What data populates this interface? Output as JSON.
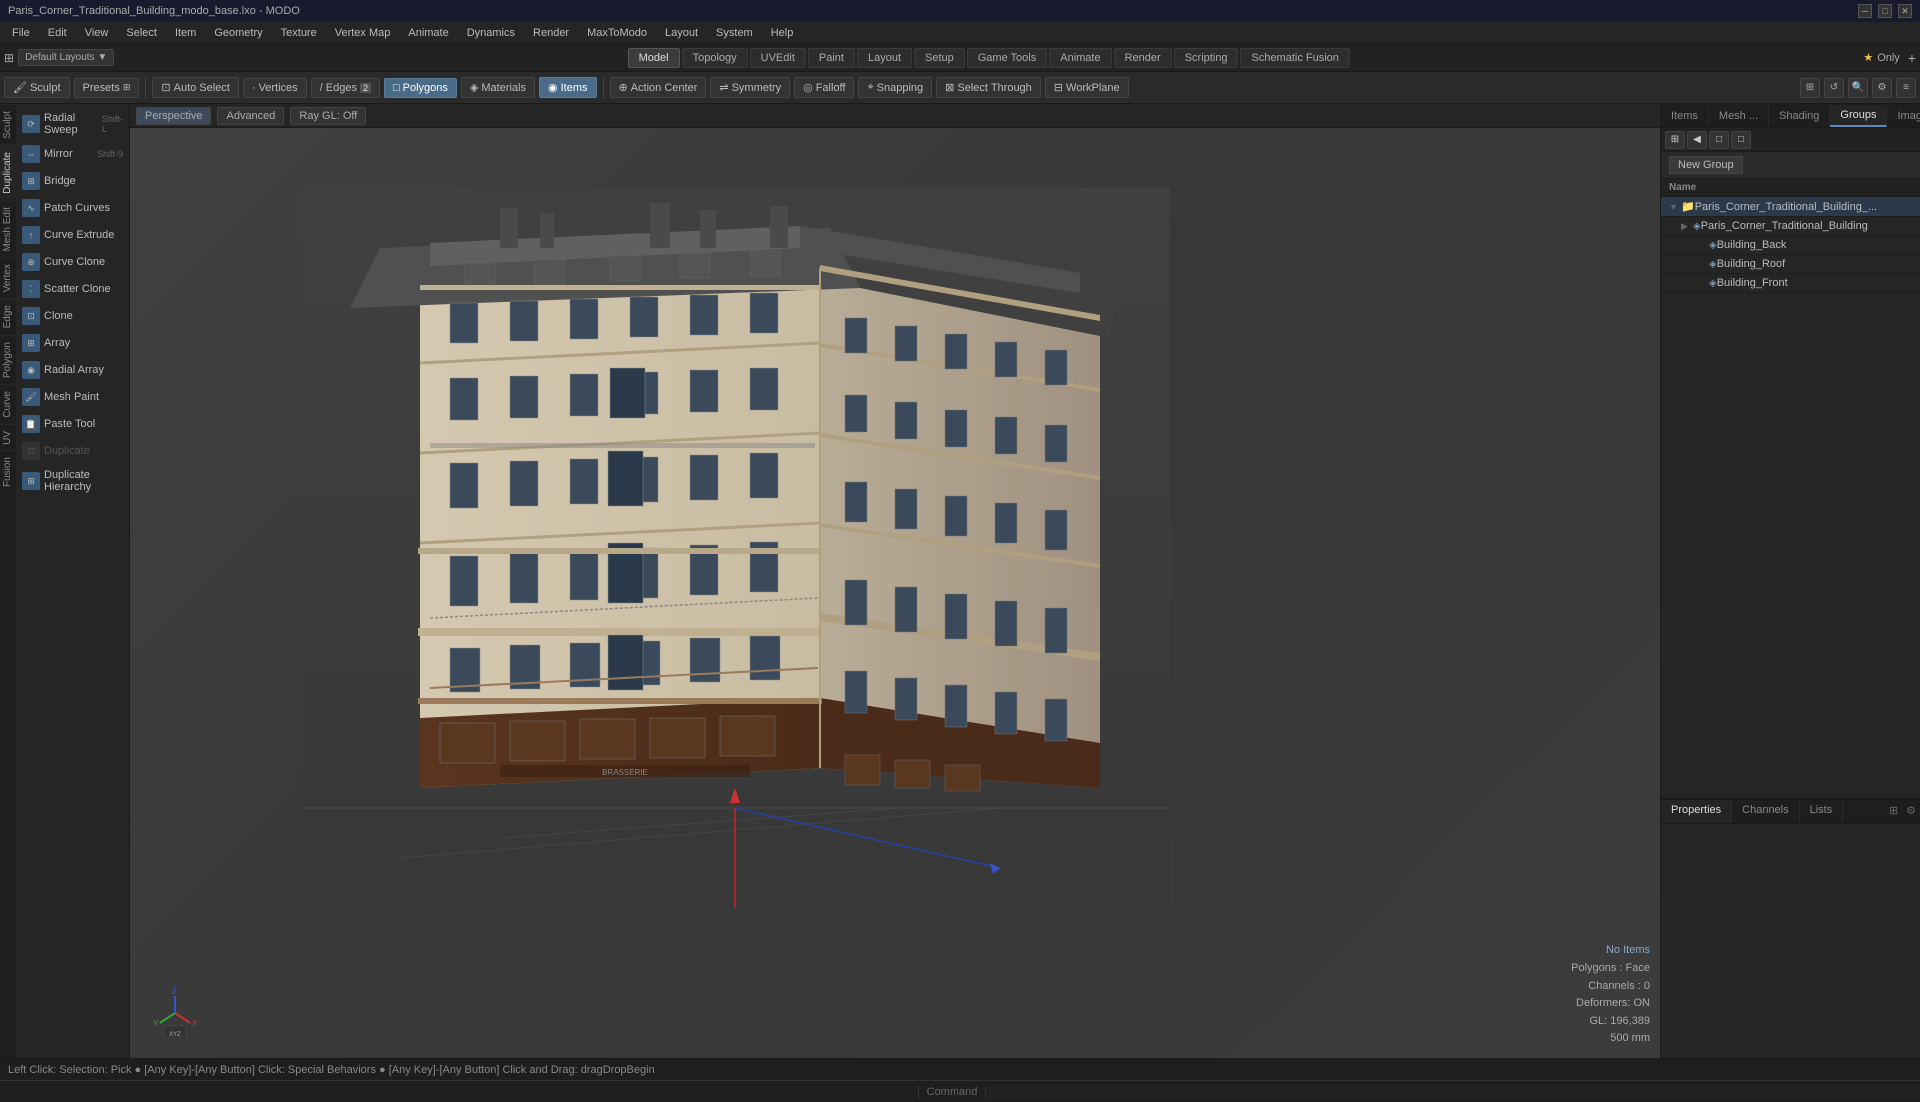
{
  "titlebar": {
    "title": "Paris_Corner_Traditional_Building_modo_base.lxo - MODO",
    "controls": [
      "─",
      "□",
      "✕"
    ]
  },
  "menubar": {
    "items": [
      "File",
      "Edit",
      "View",
      "Select",
      "Item",
      "Geometry",
      "Texture",
      "Vertex Map",
      "Animate",
      "Dynamics",
      "Render",
      "MaxToModo",
      "Layout",
      "System",
      "Help"
    ]
  },
  "layout_bar": {
    "left": {
      "label": "Default Layouts",
      "icon": "▼"
    },
    "tabs": [
      {
        "label": "Model",
        "active": true
      },
      {
        "label": "Topology",
        "active": false
      },
      {
        "label": "UVEdit",
        "active": false
      },
      {
        "label": "Paint",
        "active": false
      },
      {
        "label": "Layout",
        "active": false
      },
      {
        "label": "Setup",
        "active": false
      },
      {
        "label": "Game Tools",
        "active": false
      },
      {
        "label": "Animate",
        "active": false
      },
      {
        "label": "Render",
        "active": false
      },
      {
        "label": "Scripting",
        "active": false
      },
      {
        "label": "Schematic Fusion",
        "active": false
      }
    ],
    "right": {
      "icon": "★",
      "label": "Only",
      "plus": "+"
    }
  },
  "toolbar": {
    "sculpt_label": "Sculpt",
    "presets_label": "Presets",
    "auto_select_label": "Auto Select",
    "vertices_label": "Vertices",
    "edges_label": "Edges",
    "edges_count": "2",
    "polygons_label": "Polygons",
    "materials_label": "Materials",
    "items_label": "Items",
    "action_center_label": "Action Center",
    "symmetry_label": "Symmetry",
    "falloff_label": "Falloff",
    "snapping_label": "Snapping",
    "select_through_label": "Select Through",
    "workplane_label": "WorkPlane"
  },
  "sidebar": {
    "tabs": [
      "Sculpt",
      "Duplicate",
      "Mesh Edit",
      "Vertex",
      "Edge",
      "Polygon",
      "Curve",
      "UV",
      "Fusion"
    ],
    "tools": [
      {
        "label": "Radial Sweep",
        "shortcut": "Shift-L",
        "color": "blue",
        "disabled": false
      },
      {
        "label": "Mirror",
        "shortcut": "Shift-9",
        "color": "blue",
        "disabled": false
      },
      {
        "label": "Bridge",
        "shortcut": "",
        "color": "blue",
        "disabled": false
      },
      {
        "label": "Patch Curves",
        "shortcut": "",
        "color": "blue",
        "disabled": false
      },
      {
        "label": "Curve Extrude",
        "shortcut": "",
        "color": "blue",
        "disabled": false
      },
      {
        "label": "Curve Clone",
        "shortcut": "",
        "color": "blue",
        "disabled": false
      },
      {
        "label": "Scatter Clone",
        "shortcut": "",
        "color": "blue",
        "disabled": false
      },
      {
        "label": "Clone",
        "shortcut": "",
        "color": "blue",
        "disabled": false
      },
      {
        "label": "Array",
        "shortcut": "",
        "color": "blue",
        "disabled": false
      },
      {
        "label": "Radial Array",
        "shortcut": "",
        "color": "blue",
        "disabled": false
      },
      {
        "label": "Mesh Paint",
        "shortcut": "",
        "color": "blue",
        "disabled": false
      },
      {
        "label": "Paste Tool",
        "shortcut": "",
        "color": "blue",
        "disabled": false
      },
      {
        "label": "Duplicate",
        "shortcut": "",
        "color": "disabled",
        "disabled": true
      },
      {
        "label": "Duplicate Hierarchy",
        "shortcut": "",
        "color": "blue",
        "disabled": false
      }
    ]
  },
  "viewport": {
    "mode": "Perspective",
    "advanced_label": "Advanced",
    "ray_gl_label": "Ray GL: Off",
    "info": {
      "no_items": "No Items",
      "polygons": "Polygons : Face",
      "channels": "Channels : 0",
      "deformers": "Deformers: ON",
      "gl": "GL: 196,389",
      "size": "500 mm"
    }
  },
  "right_panel": {
    "tabs": [
      "Items",
      "Mesh ...",
      "Shading",
      "Groups",
      "Images"
    ],
    "active_tab": "Groups",
    "new_group_btn": "New Group",
    "name_header": "Name",
    "groups": [
      {
        "label": "Paris_Corner_Traditional_Building_...",
        "level": 0,
        "selected": true,
        "expanded": true,
        "icon": "folder"
      },
      {
        "label": "Paris_Corner_Traditional_Building",
        "level": 1,
        "expanded": false,
        "icon": "mesh"
      },
      {
        "label": "Building_Back",
        "level": 2,
        "expanded": false,
        "icon": "mesh"
      },
      {
        "label": "Building_Roof",
        "level": 2,
        "expanded": false,
        "icon": "mesh"
      },
      {
        "label": "Building_Front",
        "level": 2,
        "expanded": false,
        "icon": "mesh"
      }
    ]
  },
  "bottom_panel": {
    "tabs": [
      "Properties",
      "Channels",
      "Lists"
    ],
    "active_tab": "Properties"
  },
  "statusbar": {
    "text": "Left Click: Selection: Pick ● [Any Key]-[Any Button] Click: Special Behaviors ● [Any Key]-[Any Button] Click and Drag: dragDropBegin"
  },
  "command": {
    "label": "Command",
    "placeholder": ""
  }
}
